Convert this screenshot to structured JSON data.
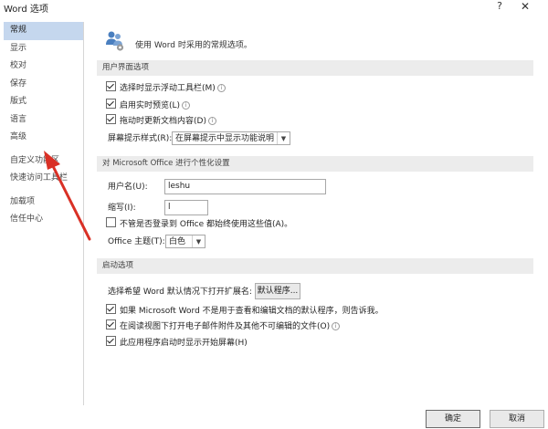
{
  "window": {
    "title": "Word 选项",
    "help": "?",
    "close": "✕"
  },
  "sidebar": {
    "items": [
      "常规",
      "显示",
      "校对",
      "保存",
      "版式",
      "语言",
      "高级",
      "自定义功能区",
      "快速访问工具栏",
      "加载项",
      "信任中心"
    ],
    "selected": "常规"
  },
  "hero": {
    "text": "使用 Word 时采用的常规选项。"
  },
  "ui_options": {
    "heading": "用户界面选项",
    "mini_toolbar": "选择时显示浮动工具栏(M)",
    "live_preview": "启用实时预览(L)",
    "update_content": "拖动时更新文档内容(D)",
    "screentip_label": "屏幕提示样式(R):",
    "screentip_value": "在屏幕提示中显示功能说明"
  },
  "personalize": {
    "heading": "对 Microsoft Office 进行个性化设置",
    "username_label": "用户名(U):",
    "username_value": "leshu",
    "initials_label": "缩写(I):",
    "initials_value": "l",
    "always_use": "不管是否登录到 Office 都始终使用这些值(A)。",
    "theme_label": "Office 主题(T):",
    "theme_value": "白色"
  },
  "startup": {
    "heading": "启动选项",
    "default_program_label": "选择希望 Word 默认情况下打开扩展名:",
    "default_program_button": "默认程序...",
    "tell_me": "如果 Microsoft Word 不是用于查看和编辑文档的默认程序，则告诉我。",
    "open_reading": "在阅读视图下打开电子邮件附件及其他不可编辑的文件(O)",
    "show_start": "此应用程序启动时显示开始屏幕(H)"
  },
  "footer": {
    "ok": "确定",
    "cancel": "取消"
  },
  "icons": {
    "info": "i",
    "dropdown": "▼"
  },
  "colors": {
    "selected_bg": "#c5d7ee",
    "section_bg": "#ececec",
    "arrow": "#d93025"
  }
}
